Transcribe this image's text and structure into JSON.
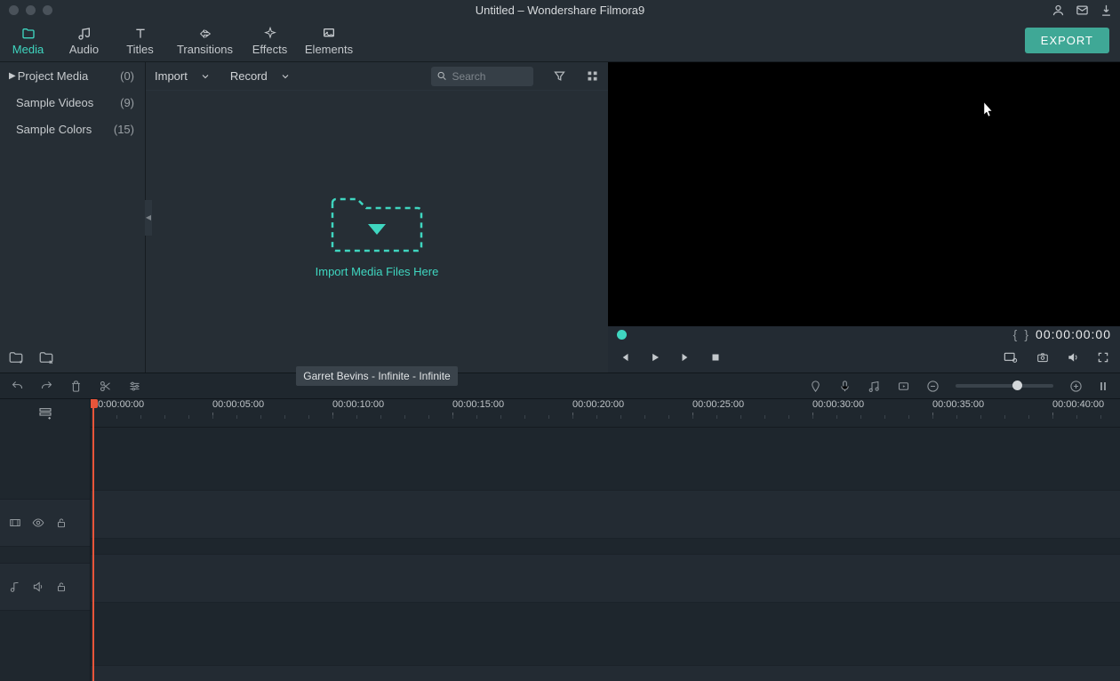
{
  "titlebar": {
    "title": "Untitled – Wondershare Filmora9"
  },
  "tabs": {
    "media": "Media",
    "audio": "Audio",
    "titles": "Titles",
    "transitions": "Transitions",
    "effects": "Effects",
    "elements": "Elements"
  },
  "export_label": "EXPORT",
  "sidebar": {
    "items": [
      {
        "name": "Project Media",
        "count": "(0)"
      },
      {
        "name": "Sample Videos",
        "count": "(9)"
      },
      {
        "name": "Sample Colors",
        "count": "(15)"
      }
    ]
  },
  "media": {
    "import": "Import",
    "record": "Record",
    "search_placeholder": "Search",
    "drop_hint": "Import Media Files Here",
    "song_tag": "Garret Bevins - Infinite - Infinite"
  },
  "preview": {
    "timecode": "00:00:00:00",
    "bracket_l": "{",
    "bracket_r": "}"
  },
  "ruler": [
    "00:00:00:00",
    "00:00:05:00",
    "00:00:10:00",
    "00:00:15:00",
    "00:00:20:00",
    "00:00:25:00",
    "00:00:30:00",
    "00:00:35:00",
    "00:00:40:00"
  ]
}
